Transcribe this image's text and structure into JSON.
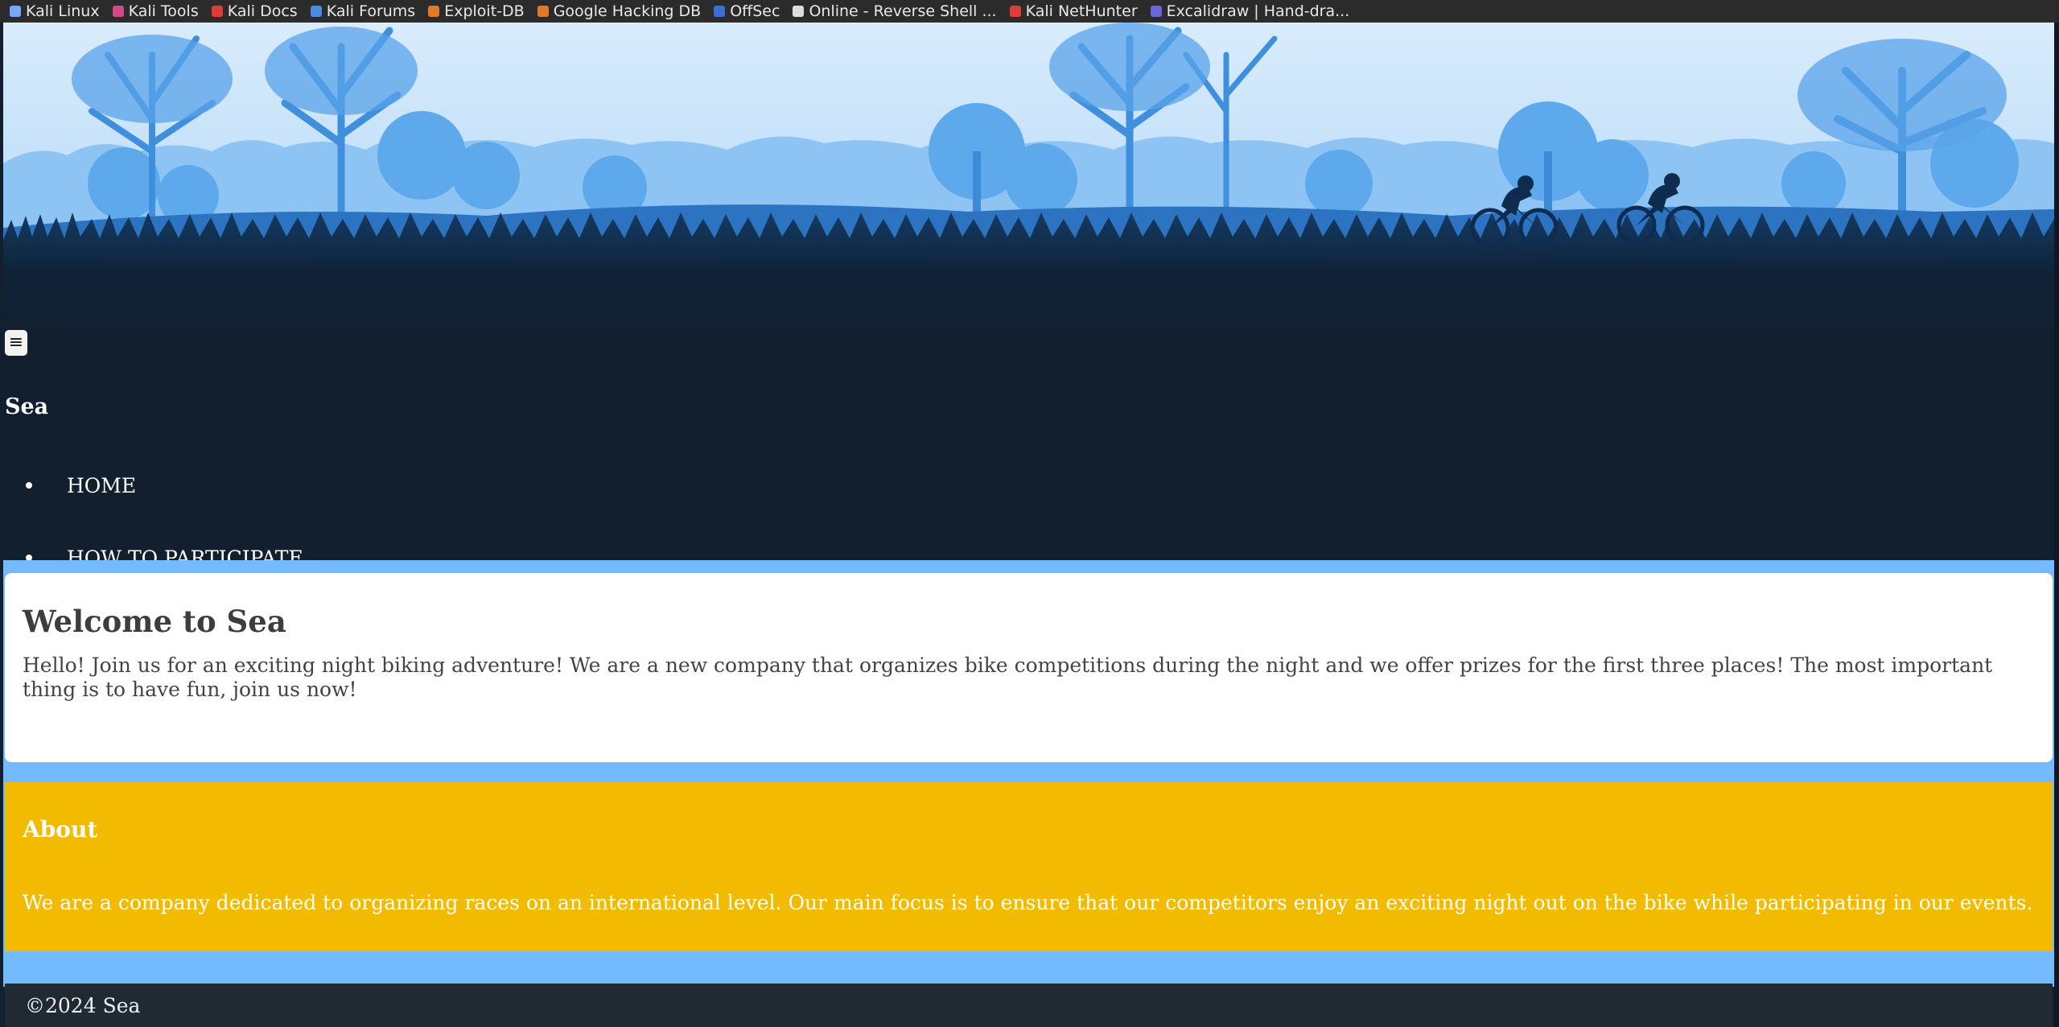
{
  "bookmarks": [
    {
      "label": "Kali Linux",
      "icon": "kali-dragon-icon",
      "color": "#7aa7ff"
    },
    {
      "label": "Kali Tools",
      "icon": "kali-tools-icon",
      "color": "#d24a8e"
    },
    {
      "label": "Kali Docs",
      "icon": "kali-docs-icon",
      "color": "#e03b3b"
    },
    {
      "label": "Kali Forums",
      "icon": "kali-forums-icon",
      "color": "#4a8de0"
    },
    {
      "label": "Exploit-DB",
      "icon": "exploit-db-icon",
      "color": "#e07a2b"
    },
    {
      "label": "Google Hacking DB",
      "icon": "ghdb-icon",
      "color": "#e07a2b"
    },
    {
      "label": "OffSec",
      "icon": "offsec-icon",
      "color": "#3a6fd8"
    },
    {
      "label": "Online - Reverse Shell ...",
      "icon": "skull-icon",
      "color": "#dddddd"
    },
    {
      "label": "Kali NetHunter",
      "icon": "nethunter-icon",
      "color": "#e03b3b"
    },
    {
      "label": "Excalidraw | Hand-dra...",
      "icon": "excalidraw-icon",
      "color": "#6965db"
    }
  ],
  "header": {
    "menu_toggle_icon": "hamburger-menu-icon",
    "site_title": "Sea"
  },
  "nav": {
    "items": [
      {
        "label": "HOME"
      },
      {
        "label": "HOW TO PARTICIPATE"
      }
    ]
  },
  "welcome": {
    "title": "Welcome to Sea",
    "text": "Hello! Join us for an exciting night biking adventure! We are a new company that organizes bike competitions during the night and we offer prizes for the first three places! The most important thing is to have fun, join us now!"
  },
  "about": {
    "title": "About",
    "text": "We are a company dedicated to organizing races on an international level. Our main focus is to ensure that our competitors enjoy an exciting night out on the bike while participating in our events."
  },
  "footer": {
    "text": "©2024 Sea"
  },
  "colors": {
    "page_bg": "#121f2f",
    "content_bg": "#74baff",
    "about_bg": "#f2bb02",
    "footer_bg": "#1f2a33",
    "sky": "#cde6fb"
  }
}
